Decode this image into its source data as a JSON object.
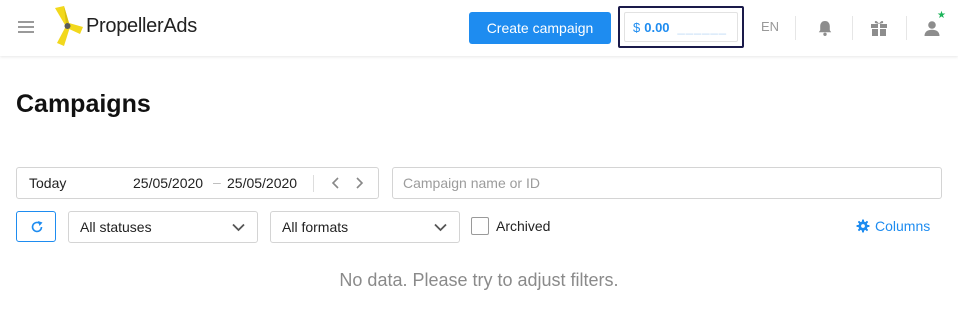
{
  "header": {
    "logo_text": "PropellerAds",
    "create_button": "Create campaign",
    "balance": {
      "currency": "$",
      "value": "0.00",
      "dash": "______"
    },
    "language": "EN",
    "icons": [
      "menu-icon",
      "bell-icon",
      "gift-icon",
      "user-icon"
    ],
    "accent": "#1e8cf0",
    "notification_color": "#1db45a"
  },
  "page": {
    "title": "Campaigns"
  },
  "filters": {
    "date": {
      "preset": "Today",
      "from": "25/05/2020",
      "separator": "–",
      "to": "25/05/2020"
    },
    "search": {
      "placeholder": "Campaign name or ID",
      "value": ""
    },
    "status_select": "All statuses",
    "format_select": "All formats",
    "archived_label": "Archived",
    "archived_checked": false,
    "columns_label": "Columns"
  },
  "results": {
    "empty_message": "No data. Please try to adjust filters."
  }
}
